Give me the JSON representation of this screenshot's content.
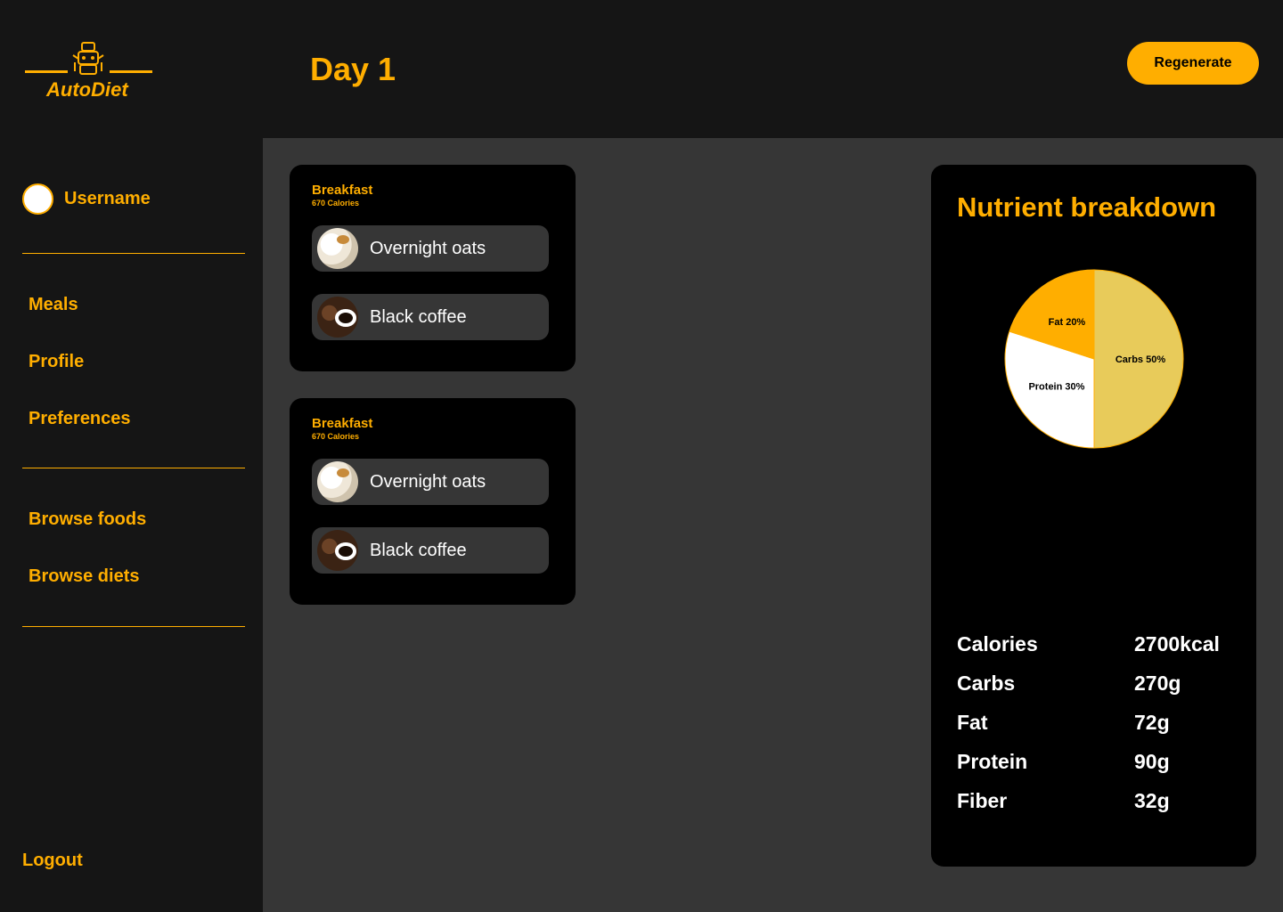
{
  "app": {
    "name": "AutoDiet"
  },
  "header": {
    "title": "Day 1",
    "regenerate_label": "Regenerate"
  },
  "sidebar": {
    "username": "Username",
    "nav_primary": [
      {
        "label": "Meals"
      },
      {
        "label": "Profile"
      },
      {
        "label": "Preferences"
      }
    ],
    "nav_secondary": [
      {
        "label": "Browse foods"
      },
      {
        "label": "Browse diets"
      }
    ],
    "logout_label": "Logout"
  },
  "meals": [
    {
      "title": "Breakfast",
      "calories": "670 Calories",
      "items": [
        {
          "name": "Overnight oats",
          "icon": "overnight-oats-photo"
        },
        {
          "name": "Black coffee",
          "icon": "black-coffee-photo"
        }
      ]
    },
    {
      "title": "Breakfast",
      "calories": "670 Calories",
      "items": [
        {
          "name": "Overnight oats",
          "icon": "overnight-oats-photo"
        },
        {
          "name": "Black coffee",
          "icon": "black-coffee-photo"
        }
      ]
    }
  ],
  "nutrients": {
    "title": "Nutrient breakdown",
    "stats": [
      {
        "label": "Calories",
        "value": "2700kcal"
      },
      {
        "label": "Carbs",
        "value": "270g"
      },
      {
        "label": "Fat",
        "value": "72g"
      },
      {
        "label": "Protein",
        "value": "90g"
      },
      {
        "label": "Fiber",
        "value": "32g"
      }
    ]
  },
  "chart_data": {
    "type": "pie",
    "title": "Nutrient breakdown",
    "slices": [
      {
        "label": "Carbs 50%",
        "value": 50,
        "color": "#E8CB5A"
      },
      {
        "label": "Protein 30%",
        "value": 30,
        "color": "#FFFFFF"
      },
      {
        "label": "Fat 20%",
        "value": 20,
        "color": "#FFAE00"
      }
    ]
  },
  "colors": {
    "accent": "#FFAE00",
    "sidebar_bg": "#151515",
    "main_bg": "#363636",
    "card_bg": "#000000"
  }
}
